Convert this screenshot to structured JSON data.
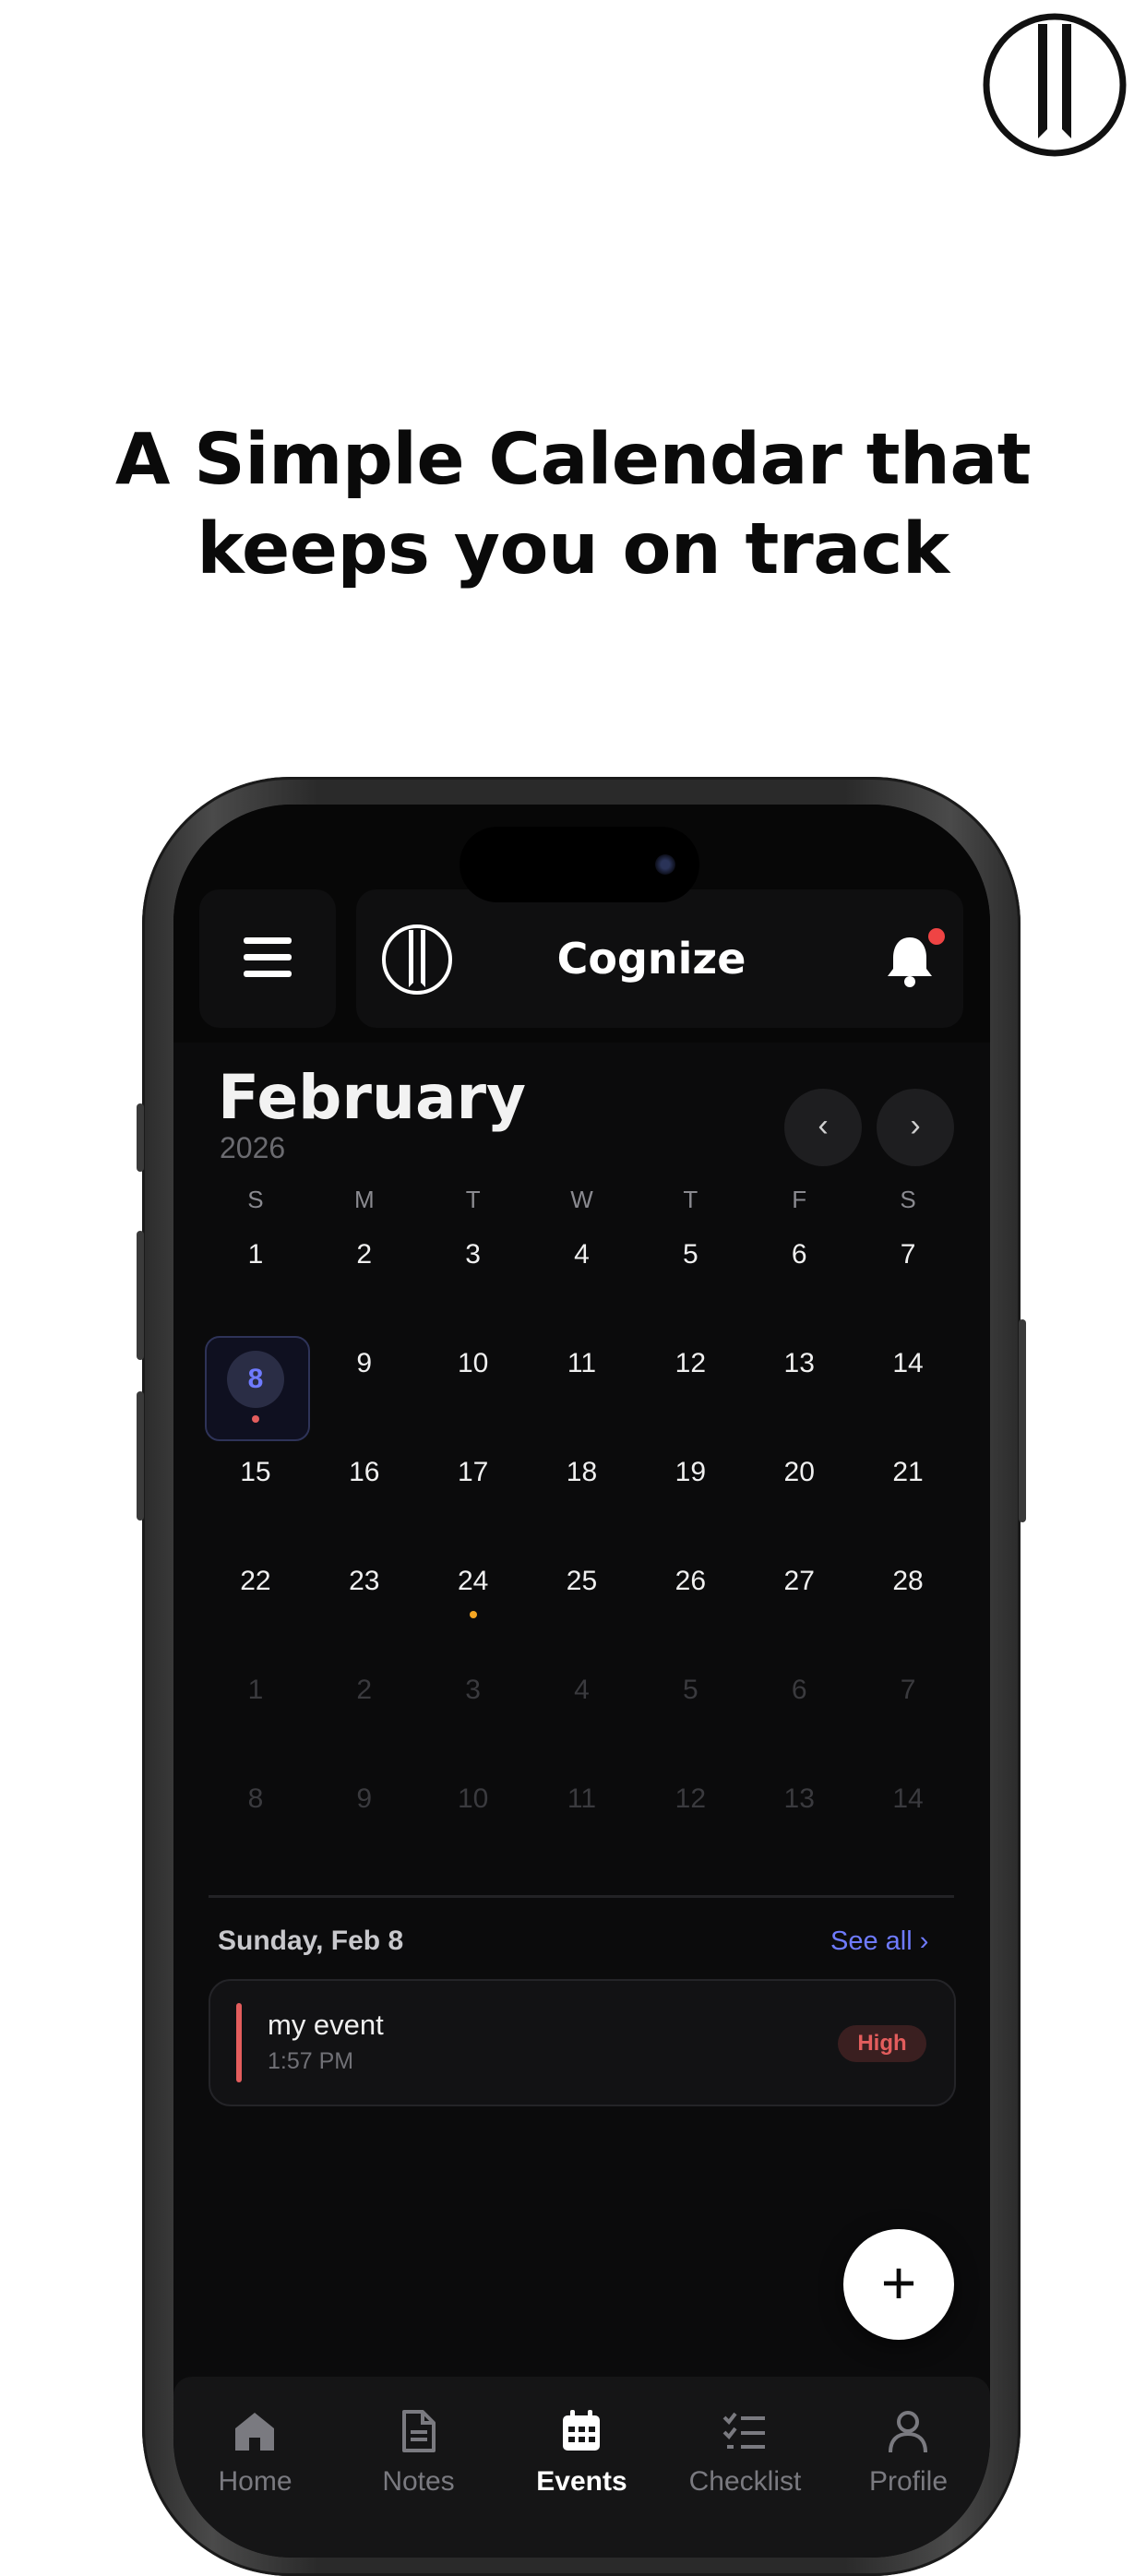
{
  "promo": {
    "headline_line1": "A Simple Calendar that",
    "headline_line2": "keeps you on track"
  },
  "app": {
    "title": "Cognize",
    "menu_icon": "hamburger-menu-icon",
    "notification_icon": "bell-icon",
    "has_unread_notifications": true
  },
  "calendar": {
    "month": "February",
    "year": "2026",
    "prev_label": "‹",
    "next_label": "›",
    "weekdays": [
      "S",
      "M",
      "T",
      "W",
      "T",
      "F",
      "S"
    ],
    "days": [
      {
        "day": "1",
        "outside": false
      },
      {
        "day": "2",
        "outside": false
      },
      {
        "day": "3",
        "outside": false
      },
      {
        "day": "4",
        "outside": false
      },
      {
        "day": "5",
        "outside": false
      },
      {
        "day": "6",
        "outside": false
      },
      {
        "day": "7",
        "outside": false
      },
      {
        "day": "8",
        "outside": false,
        "selected": true,
        "dot": "#e35d5d"
      },
      {
        "day": "9",
        "outside": false
      },
      {
        "day": "10",
        "outside": false
      },
      {
        "day": "11",
        "outside": false
      },
      {
        "day": "12",
        "outside": false
      },
      {
        "day": "13",
        "outside": false
      },
      {
        "day": "14",
        "outside": false
      },
      {
        "day": "15",
        "outside": false
      },
      {
        "day": "16",
        "outside": false
      },
      {
        "day": "17",
        "outside": false
      },
      {
        "day": "18",
        "outside": false
      },
      {
        "day": "19",
        "outside": false
      },
      {
        "day": "20",
        "outside": false
      },
      {
        "day": "21",
        "outside": false
      },
      {
        "day": "22",
        "outside": false
      },
      {
        "day": "23",
        "outside": false
      },
      {
        "day": "24",
        "outside": false,
        "dot": "#f5a623"
      },
      {
        "day": "25",
        "outside": false
      },
      {
        "day": "26",
        "outside": false
      },
      {
        "day": "27",
        "outside": false
      },
      {
        "day": "28",
        "outside": false
      },
      {
        "day": "1",
        "outside": true
      },
      {
        "day": "2",
        "outside": true
      },
      {
        "day": "3",
        "outside": true
      },
      {
        "day": "4",
        "outside": true
      },
      {
        "day": "5",
        "outside": true
      },
      {
        "day": "6",
        "outside": true
      },
      {
        "day": "7",
        "outside": true
      },
      {
        "day": "8",
        "outside": true
      },
      {
        "day": "9",
        "outside": true
      },
      {
        "day": "10",
        "outside": true
      },
      {
        "day": "11",
        "outside": true
      },
      {
        "day": "12",
        "outside": true
      },
      {
        "day": "13",
        "outside": true
      },
      {
        "day": "14",
        "outside": true
      }
    ]
  },
  "events_section": {
    "date_heading": "Sunday, Feb 8",
    "see_all": "See all ›",
    "events": [
      {
        "title": "my event",
        "time": "1:57 PM",
        "priority": "High",
        "priority_color": "#e35d5d"
      }
    ]
  },
  "fab": {
    "label": "+"
  },
  "tabbar": {
    "tabs": [
      {
        "label": "Home",
        "icon": "home-icon",
        "active": false
      },
      {
        "label": "Notes",
        "icon": "notes-icon",
        "active": false
      },
      {
        "label": "Events",
        "icon": "calendar-icon",
        "active": true
      },
      {
        "label": "Checklist",
        "icon": "checklist-icon",
        "active": false
      },
      {
        "label": "Profile",
        "icon": "profile-icon",
        "active": false
      }
    ]
  },
  "colors": {
    "accent": "#6f7bff",
    "background": "#0b0b0c",
    "high_priority": "#e35d5d",
    "event_dot_orange": "#f5a623"
  }
}
